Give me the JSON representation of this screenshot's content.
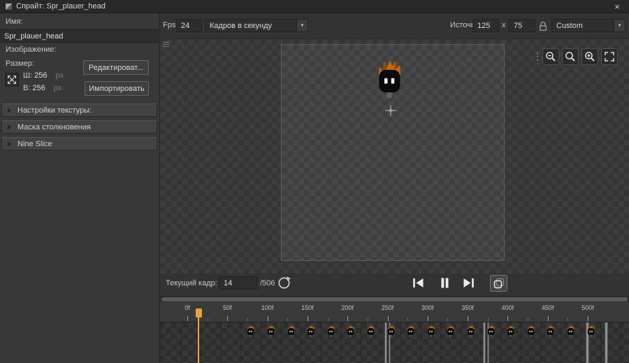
{
  "colors": {
    "accent": "#e8a33c",
    "window_bg": "#333333",
    "panel_bg": "#383838",
    "titlebar_bg": "#282828"
  },
  "window": {
    "title": "Спрайт: Spr_plauer_head",
    "close_label": "×"
  },
  "left_panel": {
    "name_label": "Имя:",
    "name_value": "Spr_plauer_head",
    "image_label": "Изображение:",
    "size_label": "Размер:",
    "width_label": "Ш:",
    "width_value": "256",
    "height_label": "В:",
    "height_value": "256",
    "px_label": "px",
    "edit_button": "Редактироват...",
    "import_button": "Импортировать",
    "sections": [
      {
        "label": "Настройки текстуры:"
      },
      {
        "label": "Маска столкновения"
      },
      {
        "label": "Nine Slice"
      }
    ]
  },
  "toolbar": {
    "fps_label": "Fps",
    "fps_value": "24",
    "fps_mode": "Кадров в секунду",
    "origin_label": "Источник",
    "origin_x": "125",
    "origin_sep": "x",
    "origin_y": "75",
    "origin_preset": "Custom"
  },
  "playback": {
    "current_frame_label": "Текущий кадр:",
    "current_frame_value": "14",
    "total_frames_label": "/506"
  },
  "timeline": {
    "playhead_frame": 14,
    "frames_per_major_tick": 50,
    "ticks": [
      "0f",
      "50f",
      "100f",
      "150f",
      "200f",
      "250f",
      "300f",
      "350f",
      "400f",
      "450f",
      "500f"
    ]
  },
  "icons": {
    "dropdown_arrow": "▼"
  }
}
